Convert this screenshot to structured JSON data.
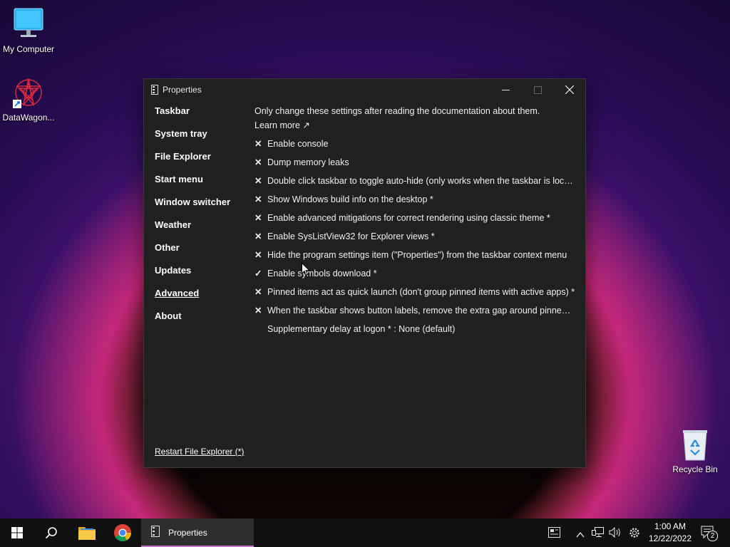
{
  "desktop": {
    "icons": [
      {
        "label": "My Computer"
      },
      {
        "label": "DataWagon..."
      },
      {
        "label": "Recycle Bin"
      }
    ]
  },
  "window": {
    "title": "Properties",
    "controls": {
      "minimize": "—",
      "maximize": "☐",
      "close": "✕"
    },
    "nav": [
      {
        "label": "Taskbar"
      },
      {
        "label": "System tray"
      },
      {
        "label": "File Explorer"
      },
      {
        "label": "Start menu"
      },
      {
        "label": "Window switcher"
      },
      {
        "label": "Weather"
      },
      {
        "label": "Other"
      },
      {
        "label": "Updates"
      },
      {
        "label": "Advanced"
      },
      {
        "label": "About"
      }
    ],
    "active_nav": "Advanced",
    "intro": "Only change these settings after reading the documentation about them.",
    "learn_more": "Learn more ↗",
    "options": [
      {
        "mark": "✕",
        "label": "Enable console"
      },
      {
        "mark": "✕",
        "label": "Dump memory leaks"
      },
      {
        "mark": "✕",
        "label": "Double click taskbar to toggle auto-hide (only works when the taskbar is locked)"
      },
      {
        "mark": "✕",
        "label": "Show Windows build info on the desktop *"
      },
      {
        "mark": "✕",
        "label": "Enable advanced mitigations for correct rendering using classic theme *"
      },
      {
        "mark": "✕",
        "label": "Enable SysListView32 for Explorer views *"
      },
      {
        "mark": "✕",
        "label": "Hide the program settings item (\"Properties\") from the taskbar context menu"
      },
      {
        "mark": "✓",
        "label": "Enable symbols download *"
      },
      {
        "mark": "✕",
        "label": "Pinned items act as quick launch (don't group pinned items with active apps) *"
      },
      {
        "mark": "✕",
        "label": "When the taskbar shows button labels, remove the extra gap around pinned ite..."
      },
      {
        "mark": "",
        "label": "Supplementary delay at logon * : None (default)"
      }
    ],
    "restart": "Restart File Explorer (*)"
  },
  "taskbar": {
    "active_app": "Properties",
    "time": "1:00 AM",
    "date": "12/22/2022",
    "notification_count": "2"
  },
  "colors": {
    "window_bg": "#202020",
    "taskbar_bg": "#101010",
    "accent": "#0078d4"
  }
}
